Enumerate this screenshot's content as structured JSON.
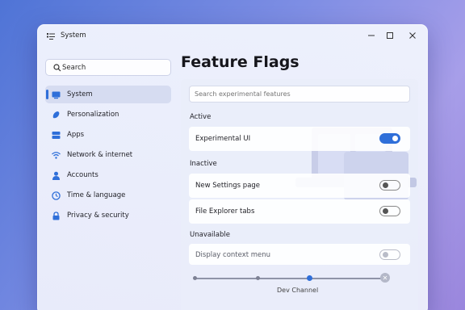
{
  "window": {
    "title": "System"
  },
  "sidebar": {
    "search_label": "Search",
    "items": [
      {
        "label": "System",
        "icon": "monitor-icon",
        "active": true
      },
      {
        "label": "Personalization",
        "icon": "paint-brush-icon"
      },
      {
        "label": "Apps",
        "icon": "apps-list-icon"
      },
      {
        "label": "Network & internet",
        "icon": "wifi-icon"
      },
      {
        "label": "Accounts",
        "icon": "person-icon"
      },
      {
        "label": "Time & language",
        "icon": "clock-globe-icon"
      },
      {
        "label": "Privacy & security",
        "icon": "lock-icon"
      }
    ]
  },
  "main": {
    "title": "Feature Flags",
    "search_placeholder": "Search experimental features",
    "sections": [
      {
        "label": "Active",
        "items": [
          {
            "label": "Experimental UI",
            "state": "on"
          }
        ]
      },
      {
        "label": "Inactive",
        "items": [
          {
            "label": "New Settings page",
            "state": "off"
          },
          {
            "label": "File Explorer tabs",
            "state": "off"
          }
        ]
      },
      {
        "label": "Unavailable",
        "items": [
          {
            "label": "Display context menu",
            "state": "disabled"
          }
        ]
      }
    ],
    "channel_slider": {
      "caption": "Dev Channel",
      "position": 0.625
    }
  },
  "colors": {
    "accent": "#2f6fd9"
  }
}
